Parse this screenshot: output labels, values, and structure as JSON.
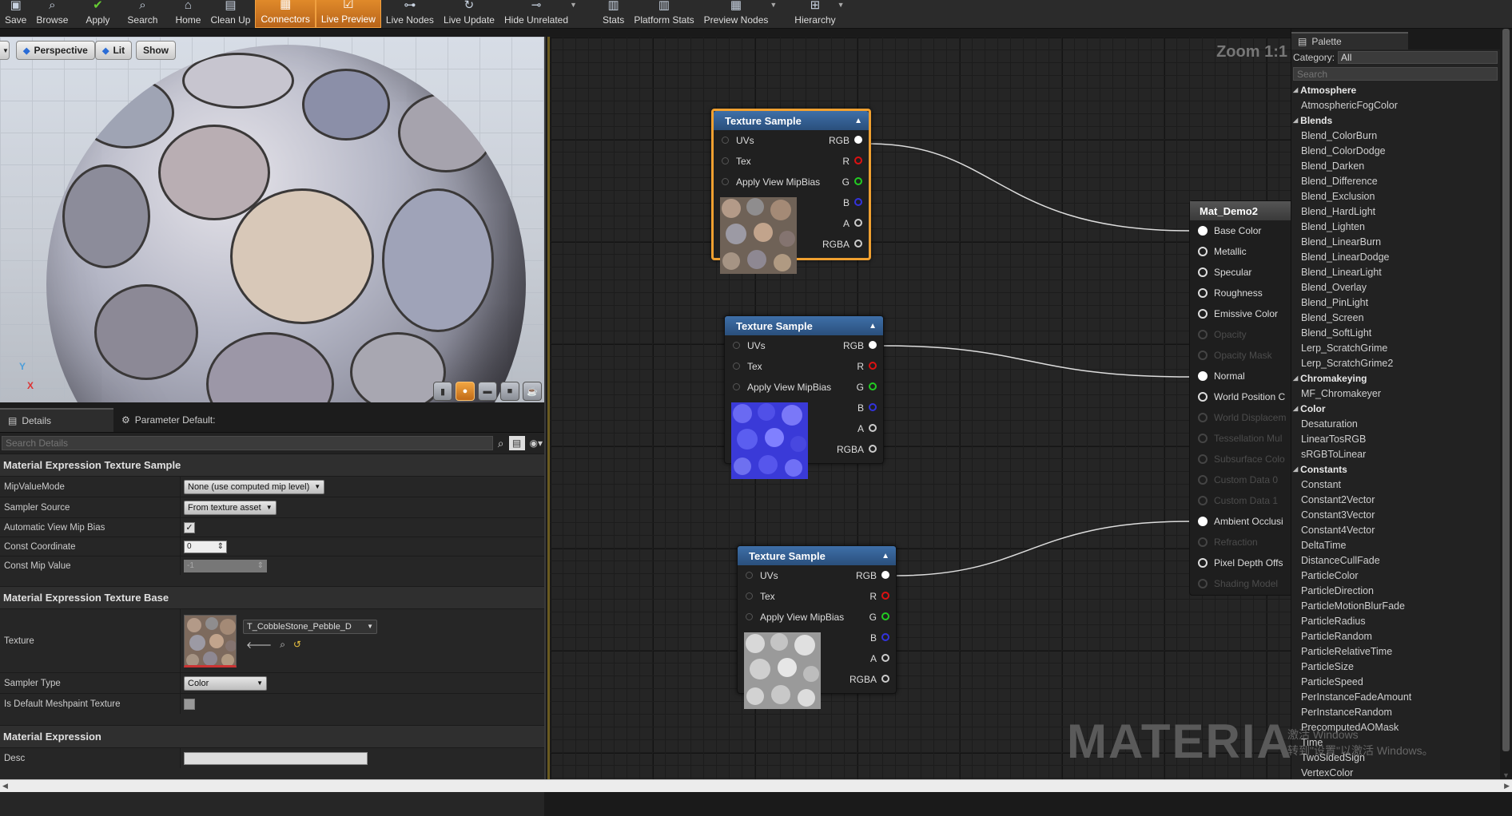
{
  "toolbar": {
    "buttons": [
      "Save",
      "Browse",
      "Apply",
      "Search",
      "Home",
      "Clean Up",
      "Connectors",
      "Live Preview",
      "Live Nodes",
      "Live Update",
      "Hide Unrelated",
      "Stats",
      "Platform Stats",
      "Preview Nodes",
      "Hierarchy"
    ]
  },
  "viewport": {
    "perspective": "Perspective",
    "lit": "Lit",
    "show": "Show",
    "axis_y": "Y",
    "axis_x": "X"
  },
  "details": {
    "tab_details": "Details",
    "tab_params": "Parameter Default:",
    "search_placeholder": "Search Details",
    "sec1": "Material Expression Texture Sample",
    "mip_label": "MipValueMode",
    "mip_value": "None (use computed mip level)",
    "sampler_source_label": "Sampler Source",
    "sampler_source_value": "From texture asset",
    "auto_mip_label": "Automatic View Mip Bias",
    "const_coord_label": "Const Coordinate",
    "const_coord_value": "0",
    "const_mip_label": "Const Mip Value",
    "const_mip_value": "-1",
    "sec2": "Material Expression Texture Base",
    "texture_label": "Texture",
    "texture_value": "T_CobbleStone_Pebble_D",
    "sampler_type_label": "Sampler Type",
    "sampler_type_value": "Color",
    "meshpaint_label": "Is Default Meshpaint Texture",
    "sec3": "Material Expression",
    "desc_label": "Desc"
  },
  "graph": {
    "zoom": "Zoom 1:1",
    "watermark": "MATERIAL",
    "nodes": [
      {
        "title": "Texture Sample",
        "pins_in": [
          "UVs",
          "Tex",
          "Apply View MipBias"
        ],
        "pins_out": [
          "RGB",
          "R",
          "G",
          "B",
          "A",
          "RGBA"
        ]
      },
      {
        "title": "Texture Sample",
        "pins_in": [
          "UVs",
          "Tex",
          "Apply View MipBias"
        ],
        "pins_out": [
          "RGB",
          "R",
          "G",
          "B",
          "A",
          "RGBA"
        ]
      },
      {
        "title": "Texture Sample",
        "pins_in": [
          "UVs",
          "Tex",
          "Apply View MipBias"
        ],
        "pins_out": [
          "RGB",
          "R",
          "G",
          "B",
          "A",
          "RGBA"
        ]
      }
    ],
    "material": {
      "title": "Mat_Demo2",
      "inputs": [
        "Base Color",
        "Metallic",
        "Specular",
        "Roughness",
        "Emissive Color",
        "Opacity",
        "Opacity Mask",
        "Normal",
        "World Position C",
        "World Displacem",
        "Tessellation Mul",
        "Subsurface Colo",
        "Custom Data 0",
        "Custom Data 1",
        "Ambient Occlusi",
        "Refraction",
        "Pixel Depth Offs",
        "Shading Model"
      ]
    }
  },
  "palette": {
    "tab": "Palette",
    "category_label": "Category:",
    "category_value": "All",
    "search_placeholder": "Search",
    "groups": [
      {
        "name": "Atmosphere",
        "items": [
          "AtmosphericFogColor"
        ]
      },
      {
        "name": "Blends",
        "items": [
          "Blend_ColorBurn",
          "Blend_ColorDodge",
          "Blend_Darken",
          "Blend_Difference",
          "Blend_Exclusion",
          "Blend_HardLight",
          "Blend_Lighten",
          "Blend_LinearBurn",
          "Blend_LinearDodge",
          "Blend_LinearLight",
          "Blend_Overlay",
          "Blend_PinLight",
          "Blend_Screen",
          "Blend_SoftLight",
          "Lerp_ScratchGrime",
          "Lerp_ScratchGrime2"
        ]
      },
      {
        "name": "Chromakeying",
        "items": [
          "MF_Chromakeyer"
        ]
      },
      {
        "name": "Color",
        "items": [
          "Desaturation",
          "LinearTosRGB",
          "sRGBToLinear"
        ]
      },
      {
        "name": "Constants",
        "items": [
          "Constant",
          "Constant2Vector",
          "Constant3Vector",
          "Constant4Vector",
          "DeltaTime",
          "DistanceCullFade",
          "ParticleColor",
          "ParticleDirection",
          "ParticleMotionBlurFade",
          "ParticleRadius",
          "ParticleRandom",
          "ParticleRelativeTime",
          "ParticleSize",
          "ParticleSpeed",
          "PerInstanceFadeAmount",
          "PerInstanceRandom",
          "PrecomputedAOMask",
          "Time",
          "TwoSidedSign",
          "VertexColor"
        ]
      }
    ]
  },
  "windows": {
    "line1": "激活 Windows",
    "line2": "转到\"设置\"以激活 Windows。"
  },
  "colors": {
    "accent": "#f0a030",
    "node_header": "#2a4f7c"
  }
}
